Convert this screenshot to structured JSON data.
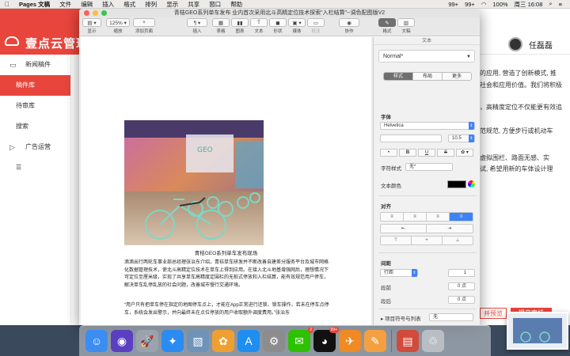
{
  "menubar": {
    "app": "Pages 文稿",
    "items": [
      "文件",
      "编辑",
      "插入",
      "格式",
      "排列",
      "显示",
      "共享",
      "窗口",
      "帮助"
    ],
    "status": [
      "99+",
      "99+",
      "100%",
      "周三 16:08"
    ]
  },
  "web": {
    "logo_text": "壹点云管理",
    "user_name": "任磊磊",
    "sidebar": [
      {
        "label": "新闻稿件",
        "icon": "doc-icon",
        "group": true
      },
      {
        "label": "稿件库",
        "active": true
      },
      {
        "label": "待审库"
      },
      {
        "label": "搜索"
      },
      {
        "label": "广告运营",
        "icon": "play-icon",
        "group": true
      },
      {
        "label": "☰",
        "icon": "menu-icon"
      }
    ],
    "right_text": [
      "的应用, 营造了创新模式, 推",
      "社会和应用价值。我们将积极",
      "，高精度定位不仅能更有效追",
      "范规范, 方便步行或机动车",
      "虚拟围栏、路面无感、实",
      "试, 希望用新的车体设计理"
    ],
    "btn_preview": "并预览",
    "btn_submit": "提交审核"
  },
  "pages": {
    "window_title": "青桔GEO系列单车发布 业内首次采用北斗高精定位技术探索“入栏结算”--调色配图版V2",
    "toolbar": [
      {
        "label": "显示",
        "box": "▤ ▾",
        "w": 24
      },
      {
        "label": "缩放",
        "box": "125% ▾",
        "w": 30
      },
      {
        "label": "添加页面",
        "box": "+",
        "w": 28
      },
      {
        "label": "插入",
        "box": "¶ ▾",
        "w": 26
      },
      {
        "label": "表格",
        "box": "▦",
        "w": 22
      },
      {
        "label": "图表",
        "box": "▮▮",
        "w": 22
      },
      {
        "label": "文本",
        "box": "T",
        "w": 22
      },
      {
        "label": "形状",
        "box": "◼",
        "w": 22
      },
      {
        "label": "媒体",
        "box": "▣ ▾",
        "w": 22
      },
      {
        "label": "批注",
        "box": "▭",
        "w": 22,
        "dim": true
      },
      {
        "label": "协作",
        "box": "◉",
        "w": 26
      },
      {
        "label": "格式",
        "box": "✎",
        "w": 22,
        "sel": true
      },
      {
        "label": "文稿",
        "box": "▥",
        "w": 22
      }
    ],
    "doc": {
      "caption": "青桔GEO系列单车发布现场",
      "para1": "滴滴出行两轮车事业部总经理张治东介绍，青桔单车研发并不断改善自建差分服务平台及城市网格化数据管理技术，使北斗高精定位技术在单车上得到应用。在接入北斗地基增强网后，理想情况下可定位至厘米级，实现了共享单车高精度定围栏的无桩式停放和入栏结算，能有效规范用户停车，解决单车乱停乱放的社会问题，改善城市慢行交通环境。",
      "para2": "“用户只有把单车停在指定的地图停车点上，才能在App正常进行还锁、锁车操作，若未在停车点停车，系统会发出警示，并向最终未在点位停放的用户收取额外调度费用。”张治东"
    },
    "inspector": {
      "header": "文本",
      "para_style": "Normal*",
      "tabs": [
        "样式",
        "布局",
        "更多"
      ],
      "font_label": "字体",
      "font": "Helvetica",
      "size": "10.5",
      "fmt_buttons": [
        "•",
        "B",
        "U",
        "S",
        "✿ ▾"
      ],
      "char_style_label": "字符样式",
      "char_style": "无*",
      "color_label": "文本颜色",
      "text_color": "#000000",
      "align_label": "对齐",
      "align": [
        "≡",
        "≡",
        "≡",
        "≡"
      ],
      "spacing_label": "间距",
      "line_mode": "行距",
      "line_value": "1",
      "before_label": "段前",
      "before_value": "0 点",
      "after_label": "段后",
      "after_value": "0 点",
      "list_label": "项目符号与列表",
      "list_value": "无"
    }
  },
  "dock": {
    "apps": [
      {
        "name": "finder-icon",
        "color": "#3b8df2",
        "glyph": "☺"
      },
      {
        "name": "siri-icon",
        "color": "#5a3fc0",
        "glyph": "◉"
      },
      {
        "name": "launchpad-icon",
        "color": "#9aa3ad",
        "glyph": "🚀"
      },
      {
        "name": "safari-icon",
        "color": "#2a8bf2",
        "glyph": "✦"
      },
      {
        "name": "preview-icon",
        "color": "#6e93b8",
        "glyph": "▧"
      },
      {
        "name": "photos-icon",
        "color": "#f0a030",
        "glyph": "✿"
      },
      {
        "name": "appstore-icon",
        "color": "#1f8ef1",
        "glyph": "A"
      },
      {
        "name": "settings-icon",
        "color": "#8c8c8c",
        "glyph": "⚙"
      },
      {
        "name": "wechat-icon",
        "color": "#2dc100",
        "glyph": "✉",
        "badge": "2"
      },
      {
        "name": "qq-icon",
        "color": "#111",
        "glyph": "◕",
        "badge": "99+"
      },
      {
        "name": "airplane-icon",
        "color": "#f08a24",
        "glyph": "✈"
      },
      {
        "name": "pages-icon",
        "color": "#f4a040",
        "glyph": "✎"
      },
      {
        "name": "document-icon",
        "color": "#d24a3a",
        "glyph": "▤"
      },
      {
        "name": "trash-icon",
        "color": "#b9bec4",
        "glyph": "♲"
      }
    ]
  }
}
